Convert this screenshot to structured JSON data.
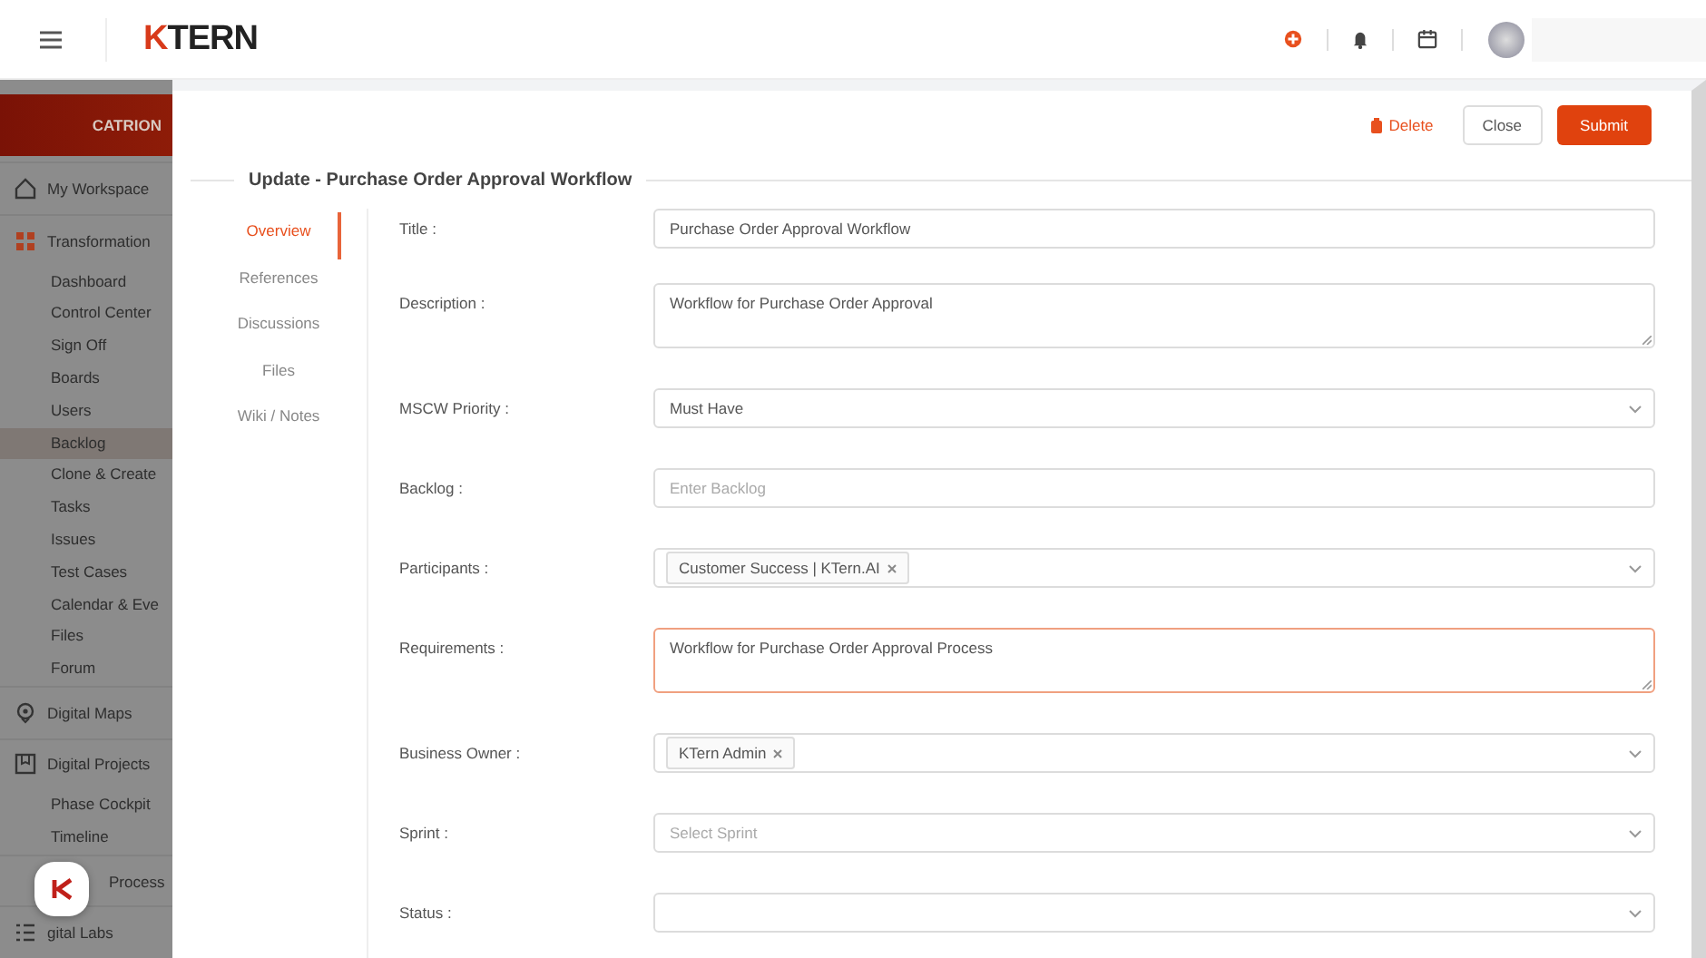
{
  "header": {
    "logo": "KTERN"
  },
  "sidebar": {
    "org": "CATRION",
    "items": [
      {
        "kind": "section",
        "label": "My Workspace",
        "selected": false
      },
      {
        "kind": "section",
        "label": "Transformation",
        "selected": false
      },
      {
        "kind": "sub",
        "label": "Dashboard",
        "selected": false
      },
      {
        "kind": "sub",
        "label": "Control Center",
        "selected": false
      },
      {
        "kind": "sub",
        "label": "Sign Off",
        "selected": false
      },
      {
        "kind": "sub",
        "label": "Boards",
        "selected": false
      },
      {
        "kind": "sub",
        "label": "Users",
        "selected": false
      },
      {
        "kind": "sub",
        "label": "Backlog",
        "selected": true
      },
      {
        "kind": "sub",
        "label": "Clone & Create",
        "selected": false
      },
      {
        "kind": "sub",
        "label": "Tasks",
        "selected": false
      },
      {
        "kind": "sub",
        "label": "Issues",
        "selected": false
      },
      {
        "kind": "sub",
        "label": "Test Cases",
        "selected": false
      },
      {
        "kind": "sub",
        "label": "Calendar & Eve",
        "selected": false
      },
      {
        "kind": "sub",
        "label": "Files",
        "selected": false
      },
      {
        "kind": "sub",
        "label": "Forum",
        "selected": false
      },
      {
        "kind": "section",
        "label": "Digital Maps",
        "selected": false
      },
      {
        "kind": "section",
        "label": "Digital Projects",
        "selected": false
      },
      {
        "kind": "sub",
        "label": "Phase Cockpit",
        "selected": false
      },
      {
        "kind": "sub",
        "label": "Timeline",
        "selected": false
      },
      {
        "kind": "section",
        "label": "Process",
        "selected": false
      },
      {
        "kind": "section",
        "label": "gital Labs",
        "selected": false
      }
    ]
  },
  "panel": {
    "actions": [
      "Delete",
      "Close",
      "Submit"
    ],
    "title": "Update - Purchase Order Approval Workflow",
    "nav": [
      {
        "label": "Overview",
        "selected": true
      },
      {
        "label": "References",
        "selected": false
      },
      {
        "label": "Discussions",
        "selected": false
      },
      {
        "label": "Files",
        "selected": false
      },
      {
        "label": "Wiki / Notes",
        "selected": false
      }
    ],
    "fields": [
      {
        "label": "Title :",
        "kind": "input",
        "value": "Purchase Order Approval Workflow",
        "focused": false
      },
      {
        "label": "Description :",
        "kind": "textarea",
        "value": "Workflow for Purchase Order Approval",
        "focused": false
      },
      {
        "label": "MSCW Priority :",
        "kind": "select",
        "value": "Must Have",
        "focused": false
      },
      {
        "label": "Backlog :",
        "kind": "input",
        "placeholder": "Enter Backlog",
        "focused": false
      },
      {
        "label": "Participants :",
        "kind": "tags",
        "tags": [
          "Customer Success | KTern.AI"
        ],
        "focused": false
      },
      {
        "label": "Requirements :",
        "kind": "textarea",
        "value": "Workflow for Purchase Order Approval Process",
        "focused": true
      },
      {
        "label": "Business Owner :",
        "kind": "tags",
        "tags": [
          "KTern Admin"
        ],
        "focused": false
      },
      {
        "label": "Sprint :",
        "kind": "select",
        "placeholder": "Select Sprint",
        "focused": false
      },
      {
        "label": "Status :",
        "kind": "select",
        "focused": false
      }
    ]
  }
}
